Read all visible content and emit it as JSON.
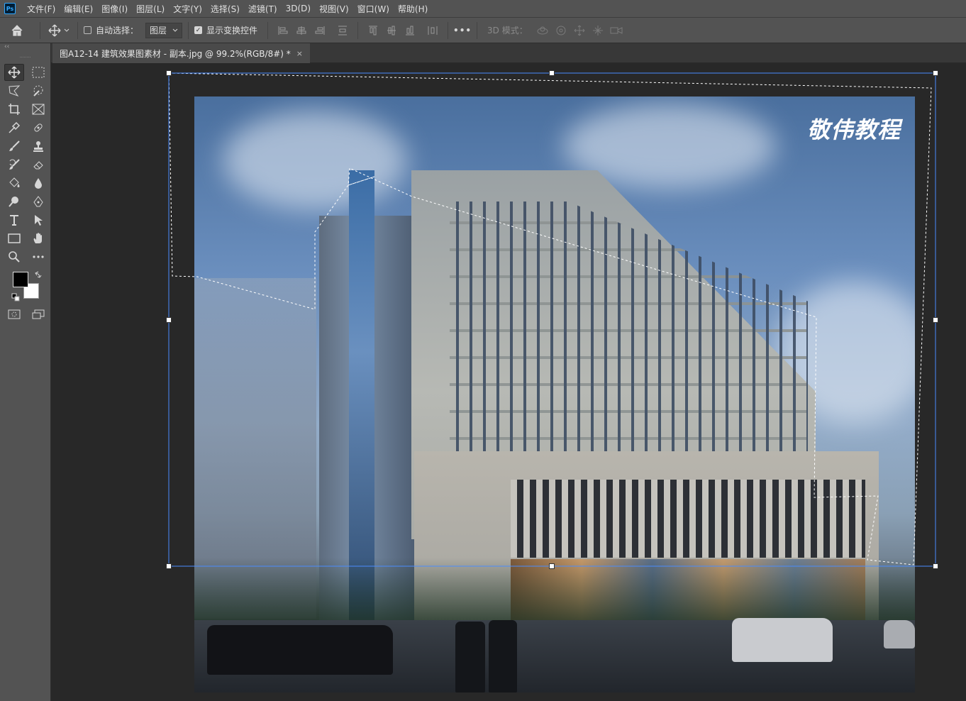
{
  "app": {
    "logo": "Ps"
  },
  "menu": [
    "文件(F)",
    "编辑(E)",
    "图像(I)",
    "图层(L)",
    "文字(Y)",
    "选择(S)",
    "滤镜(T)",
    "3D(D)",
    "视图(V)",
    "窗口(W)",
    "帮助(H)"
  ],
  "options": {
    "auto_select_label": "自动选择：",
    "auto_select_checked": false,
    "target_value": "图层",
    "show_transform_label": "显示变换控件",
    "show_transform_checked": true,
    "more_label": "•••",
    "mode3d_label": "3D 模式："
  },
  "toolbar": {
    "collapse_label": "‹‹"
  },
  "document": {
    "tab_title": "图A12-14 建筑效果图素材 - 副本.jpg @ 99.2%(RGB/8#) *",
    "close_label": "×",
    "watermark": "敬伟教程"
  },
  "colors": {
    "foreground": "#000000",
    "background": "#ffffff",
    "accent": "#4a8cff"
  }
}
